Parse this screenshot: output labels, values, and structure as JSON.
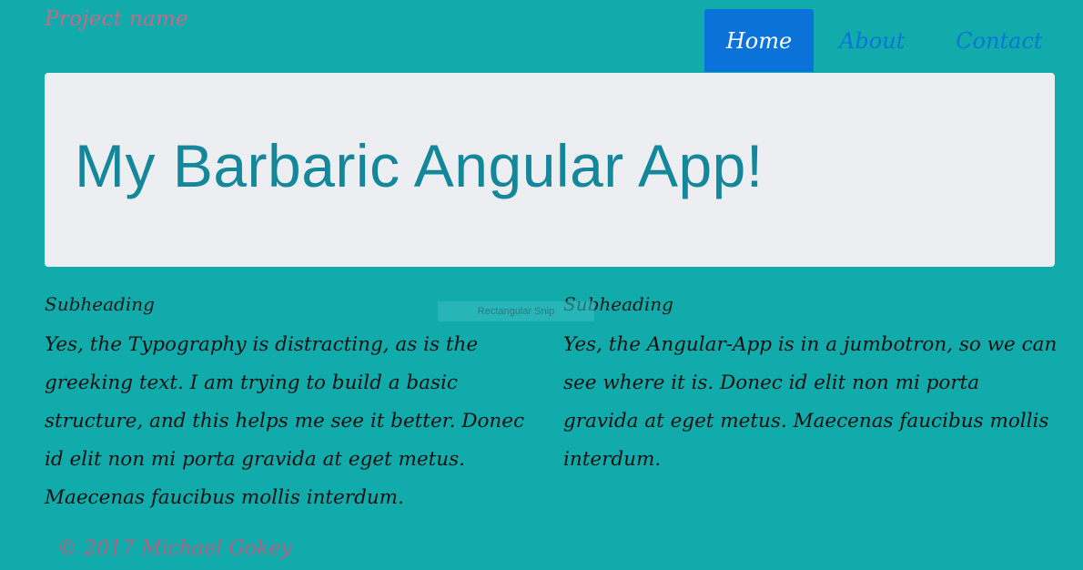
{
  "navbar": {
    "brand": "Project name",
    "items": [
      {
        "label": "Home",
        "active": true
      },
      {
        "label": "About",
        "active": false
      },
      {
        "label": "Contact",
        "active": false
      }
    ]
  },
  "jumbotron": {
    "title": "My Barbaric Angular App!"
  },
  "columns": [
    {
      "heading": "Subheading",
      "text": "Yes, the Typography is distracting, as is the greeking text. I am trying to build a basic structure, and this helps me see it better. Donec id elit non mi porta gravida at eget metus. Maecenas faucibus mollis interdum."
    },
    {
      "heading": "Subheading",
      "text": "Yes, the Angular-App is in a jumbotron, so we can see where it is. Donec id elit non mi porta gravida at eget metus. Maecenas faucibus mollis interdum."
    }
  ],
  "tooltip": "Rectangular Snip",
  "footer": "© 2017 Michael Gokey",
  "colors": {
    "background": "#11abab",
    "jumbotron": "#edeef1",
    "title": "#14889a",
    "nav_active": "#0b72d9",
    "nav_link": "#0a75d6",
    "brand": "#c46a88"
  }
}
